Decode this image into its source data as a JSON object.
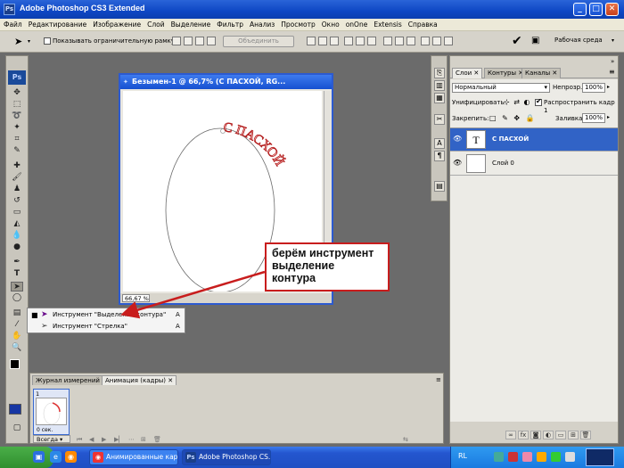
{
  "window": {
    "title": "Adobe Photoshop CS3 Extended",
    "logo": "Ps",
    "controls": {
      "minimize": "_",
      "maximize": "□",
      "close": "✕"
    }
  },
  "menu": [
    "Файл",
    "Редактирование",
    "Изображение",
    "Слой",
    "Выделение",
    "Фильтр",
    "Анализ",
    "Просмотр",
    "Окно",
    "onOne",
    "Extensis",
    "Справка"
  ],
  "options_bar": {
    "show_bounds_label": "Показывать ограничительную рамку",
    "combine_button": "Объединить",
    "workspace_label": "Рабочая среда"
  },
  "toolbox": {
    "logo": "Ps",
    "flyout": [
      {
        "label": "Инструмент \"Выделение контура\"",
        "key": "A",
        "selected": true
      },
      {
        "label": "Инструмент \"Стрелка\"",
        "key": "A",
        "selected": false
      }
    ]
  },
  "document": {
    "title": "Безымен-1 @ 66,7% (С ПАСХОЙ, RG...",
    "zoom": "66,67 %",
    "path_text": "С ПАСХОЙ"
  },
  "callout": {
    "lines": [
      "берём инструмент",
      "выделение",
      "контура"
    ]
  },
  "layers_panel": {
    "tabs": [
      "Слои",
      "Контуры",
      "Каналы"
    ],
    "blend_mode": "Нормальный",
    "opacity_label": "Непрозр.:",
    "opacity_value": "100%",
    "unify_label": "Унифицировать:",
    "propagate_label": "Распространить кадр 1",
    "lock_label": "Закрепить:",
    "fill_label": "Заливка:",
    "fill_value": "100%",
    "layers": [
      {
        "name": "С ПАСХОЙ",
        "thumb": "T",
        "selected": true
      },
      {
        "name": "Слой 0",
        "thumb": "",
        "selected": false
      }
    ],
    "selected_color": "#3163c6"
  },
  "animation_panel": {
    "tabs": [
      "Журнал измерений",
      "Анимация (кадры)"
    ],
    "frame_number": "1",
    "frame_time": "0 сек.",
    "loop": "Всегда"
  },
  "taskbar": {
    "items": [
      {
        "label": "Анимированные кар...",
        "icon": "browser-icon",
        "active": false
      },
      {
        "label": "Adobe Photoshop CS...",
        "icon": "photoshop-icon",
        "active": true
      }
    ],
    "language": "RL"
  }
}
